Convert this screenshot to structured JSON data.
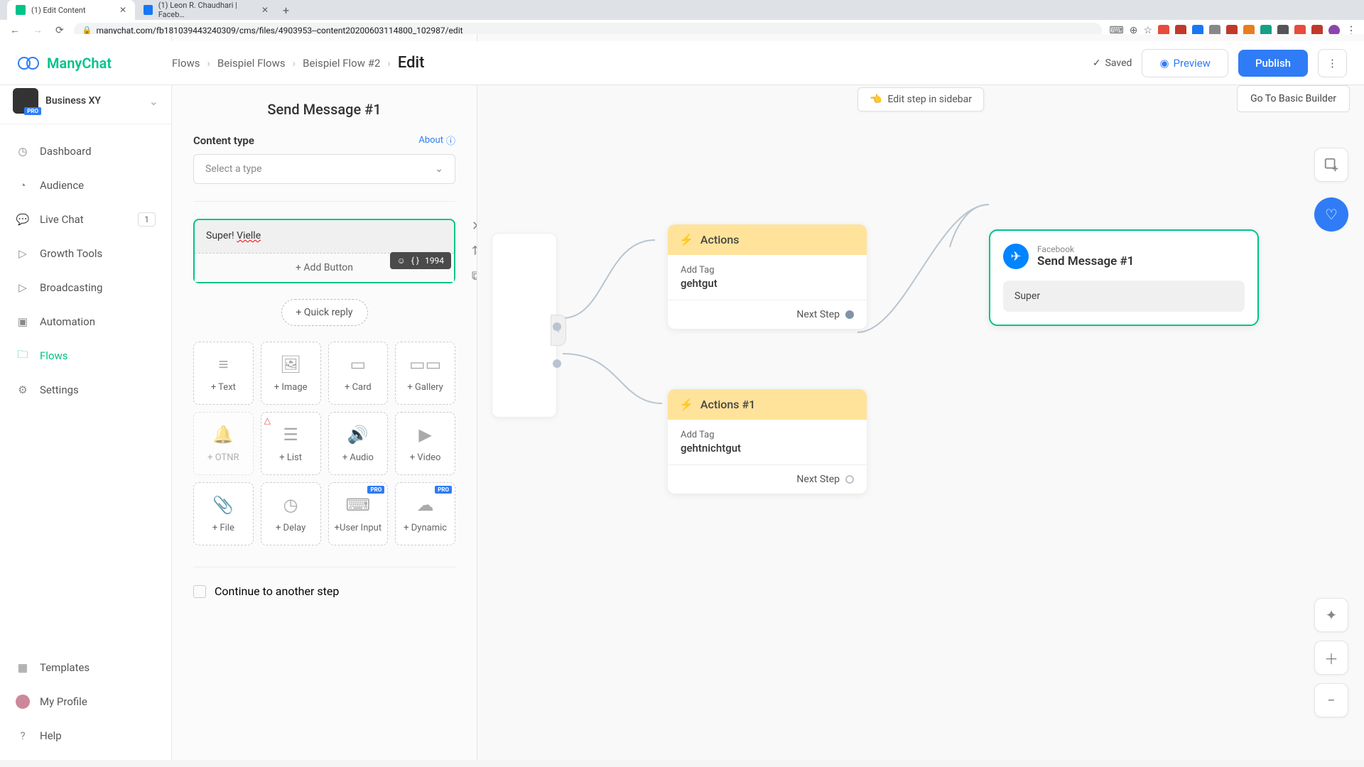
{
  "browser": {
    "tabs": [
      {
        "title": "(1) Edit Content",
        "favicon": "#00c389"
      },
      {
        "title": "(1) Leon R. Chaudhari | Faceb…",
        "favicon": "#1877f2"
      }
    ],
    "url": "manychat.com/fb181039443240309/cms/files/4903953--content20200603114800_102987/edit"
  },
  "logo": "ManyChat",
  "breadcrumb": {
    "items": [
      "Flows",
      "Beispiel Flows",
      "Beispiel Flow #2"
    ],
    "current": "Edit"
  },
  "topbar": {
    "saved": "Saved",
    "preview": "Preview",
    "publish": "Publish"
  },
  "org": {
    "name": "Business XY",
    "badge": "PRO"
  },
  "nav": {
    "dashboard": "Dashboard",
    "audience": "Audience",
    "livechat": "Live Chat",
    "livechat_badge": "1",
    "growth": "Growth Tools",
    "broadcasting": "Broadcasting",
    "automation": "Automation",
    "flows": "Flows",
    "settings": "Settings",
    "templates": "Templates",
    "profile": "My Profile",
    "help": "Help"
  },
  "editor": {
    "title": "Send Message #1",
    "content_type_label": "Content type",
    "about": "About",
    "select_placeholder": "Select a type",
    "text_value_plain": "Super! ",
    "text_value_spell": "Vielle",
    "char_remaining": "1994",
    "add_button": "+ Add Button",
    "quick_reply": "+ Quick reply",
    "tiles": {
      "text": "+ Text",
      "image": "+ Image",
      "card": "+ Card",
      "gallery": "+ Gallery",
      "otnr": "+ OTNR",
      "list": "+ List",
      "audio": "+ Audio",
      "video": "+ Video",
      "file": "+ File",
      "delay": "+ Delay",
      "userinput": "+User Input",
      "dynamic": "+ Dynamic"
    },
    "continue": "Continue to another step"
  },
  "canvas": {
    "edit_sidebar": "Edit step in sidebar",
    "basic_builder": "Go To Basic Builder",
    "actions1": {
      "title": "Actions",
      "label": "Add Tag",
      "value": "gehtgut",
      "next": "Next Step"
    },
    "actions2": {
      "title": "Actions #1",
      "label": "Add Tag",
      "value": "gehtnichtgut",
      "next": "Next Step"
    },
    "msg": {
      "platform": "Facebook",
      "title": "Send Message #1",
      "bubble": "Super"
    }
  }
}
